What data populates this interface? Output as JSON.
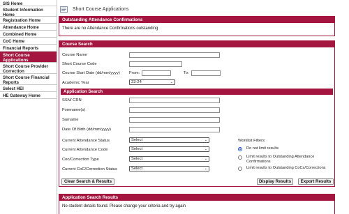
{
  "sidebar": {
    "items": [
      {
        "label": "SIS Home"
      },
      {
        "label": "Student Information Home"
      },
      {
        "label": "Registration Home"
      },
      {
        "label": "Attendance Home"
      },
      {
        "label": "Combined Home"
      },
      {
        "label": "CoC Home"
      },
      {
        "label": "Financial Reports"
      },
      {
        "label": "Short Course Applications"
      },
      {
        "label": "Short Course Provider Correction"
      },
      {
        "label": "Short Course Financial Reports"
      },
      {
        "label": "Select HEI"
      },
      {
        "label": "HE Gateway Home"
      }
    ],
    "active_index": 7
  },
  "header": {
    "title": "Short Course Applications",
    "icon": "document-icon"
  },
  "attendance": {
    "heading": "Outstanding Attendance Confirmations",
    "message": "There are no Attendance Confirmations outstanding"
  },
  "course_search": {
    "heading": "Course Search",
    "course_name_label": "Course Name",
    "course_name_value": "",
    "course_code_label": "Short Course Code",
    "course_code_value": "",
    "start_date_label": "Course Start Date  (dd/mm/yyyy)",
    "from_label": "From:",
    "from_value": "",
    "to_label": "To:",
    "to_value": "",
    "academic_year_label": "Academic Year",
    "academic_year_value": "23-24"
  },
  "application_search": {
    "heading": "Application Search",
    "ssn_label": "SSN/ CRN",
    "forenames_label": "Forename(s)",
    "surname_label": "Surname",
    "dob_label": "Date Of Birth (dd/mm/yyyy)",
    "attendance_status_label": "Current Attendance Status",
    "attendance_status_value": "Select",
    "attendance_code_label": "Current Attendance Code",
    "attendance_code_value": "Select",
    "coc_type_label": "Coc/Correction Type",
    "coc_type_value": "Select",
    "coc_status_label": "Current CoC/Correction Status",
    "coc_status_value": "Select",
    "worklist_label": "Worklist Filters:",
    "worklist_options": [
      {
        "label": "Do not limit results",
        "checked": true
      },
      {
        "label": "Limit results to Outstanding Attendance Confirmations",
        "checked": false
      },
      {
        "label": "Limit results to Outstanding CoCs/Corrections",
        "checked": false
      }
    ]
  },
  "buttons": {
    "clear": "Clear Search & Results",
    "display": "Display Results",
    "export": "Export Results"
  },
  "results": {
    "heading": "Application Search Results",
    "message": "No student details found. Please change your criteria and try again"
  }
}
